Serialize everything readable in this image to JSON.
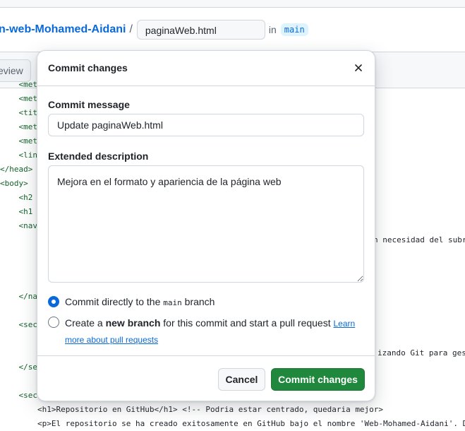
{
  "header": {
    "repo_name": "n-web-Mohamed-Aidani",
    "separator": "/",
    "file_name": "paginaWeb.html",
    "in_label": "in",
    "branch": "main"
  },
  "toolbar": {
    "preview_tab": "eview"
  },
  "code_lines": [
    "    <met",
    "    <met",
    "    <tit",
    "    <met",
    "    <met",
    "    <lin",
    "</head>",
    "<body>",
    "    <h2",
    "    <h1",
    "    <nav",
    "n necesidad del subr",
    "    </na",
    "    <sec",
    "izando Git para gest",
    "    </se",
    "    <sec",
    "        <h1>Repositorio en GitHub</h1> <!-- Podria estar centrado, quedaria mejor>",
    "        <p>El repositorio se ha creado exitosamente en GitHub bajo el nombre 'Web-Mohamed-Aidani'. De"
  ],
  "dialog": {
    "title": "Commit changes",
    "close_icon": "x-icon",
    "commit_message_label": "Commit message",
    "commit_message_value": "Update paginaWeb.html",
    "extended_description_label": "Extended description",
    "extended_description_value": "Mejora en el formato y apariencia de la página web",
    "option_direct": {
      "prefix": "Commit directly to the ",
      "branch": "main",
      "suffix": " branch",
      "selected": true
    },
    "option_new_branch": {
      "prefix": "Create a ",
      "bold": "new branch",
      "suffix": " for this commit and start a pull request ",
      "link": "Learn more about pull requests",
      "selected": false
    },
    "cancel_label": "Cancel",
    "commit_label": "Commit changes"
  },
  "colors": {
    "accent": "#0969da",
    "primary_button": "#1f883d"
  }
}
